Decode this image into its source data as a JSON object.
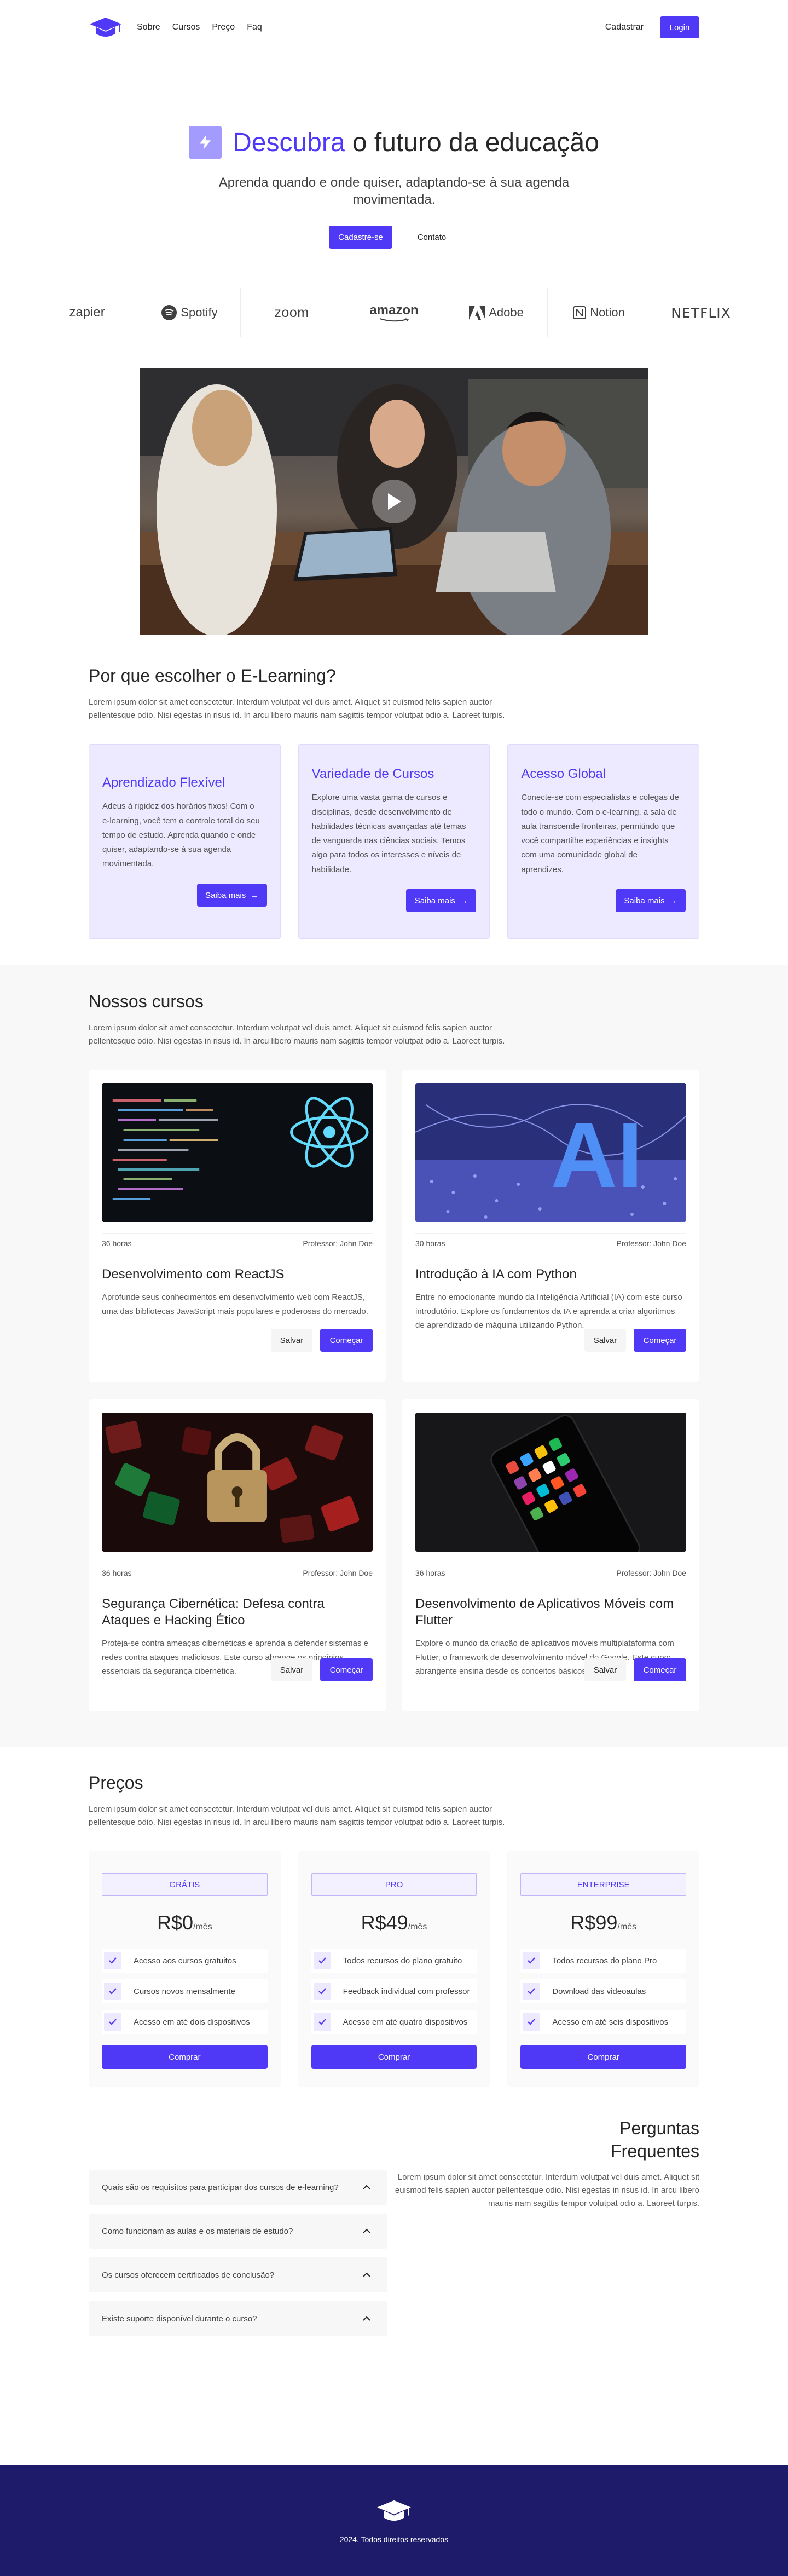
{
  "nav": {
    "links": [
      "Sobre",
      "Cursos",
      "Preço",
      "Faq"
    ],
    "register": "Cadastrar",
    "login": "Login"
  },
  "hero": {
    "title_accent": "Descubra",
    "title_rest": " o futuro da educação",
    "subtitle": "Aprenda quando e onde quiser, adaptando-se à sua agenda movimentada.",
    "cta_primary": "Cadastre-se",
    "cta_secondary": "Contato"
  },
  "brands": [
    "zapier",
    "Spotify",
    "zoom",
    "amazon",
    "Adobe",
    "Notion",
    "NETFLIX"
  ],
  "why": {
    "title": "Por que escolher o E-Learning?",
    "description": "Lorem ipsum dolor sit amet consectetur. Interdum volutpat vel duis amet. Aliquet sit euismod felis sapien auctor pellentesque odio. Nisi egestas in risus id. In arcu libero mauris nam sagittis tempor volutpat odio a. Laoreet turpis.",
    "features": [
      {
        "title": "Aprendizado Flexível",
        "text": "Adeus à rigidez dos horários fixos! Com o e-learning, você tem o controle total do seu tempo de estudo. Aprenda quando e onde quiser, adaptando-se à sua agenda movimentada.",
        "button": "Saiba mais"
      },
      {
        "title": "Variedade de Cursos",
        "text": "Explore uma vasta gama de cursos e disciplinas, desde desenvolvimento de habilidades técnicas avançadas até temas de vanguarda nas ciências sociais. Temos algo para todos os interesses e níveis de habilidade.",
        "button": "Saiba mais"
      },
      {
        "title": "Acesso Global",
        "text": "Conecte-se com especialistas e colegas de todo o mundo. Com o e-learning, a sala de aula transcende fronteiras, permitindo que você compartilhe experiências e insights com uma comunidade global de aprendizes.",
        "button": "Saiba mais"
      }
    ]
  },
  "courses": {
    "title": "Nossos cursos",
    "description": "Lorem ipsum dolor sit amet consectetur. Interdum volutpat vel duis amet. Aliquet sit euismod felis sapien auctor pellentesque odio. Nisi egestas in risus id. In arcu libero mauris nam sagittis tempor volutpat odio a. Laoreet turpis.",
    "items": [
      {
        "duration": "36 horas",
        "teacher": "Professor: John Doe",
        "title": "Desenvolvimento com ReactJS",
        "text": "Aprofunde seus conhecimentos em desenvolvimento web com ReactJS, uma das bibliotecas JavaScript mais populares e poderosas do mercado.",
        "save": "Salvar",
        "start": "Começar"
      },
      {
        "duration": "30 horas",
        "teacher": "Professor: John Doe",
        "title": "Introdução à IA com Python",
        "text": "Entre no emocionante mundo da Inteligência Artificial (IA) com este curso introdutório. Explore os fundamentos da IA e aprenda a criar algoritmos de aprendizado de máquina utilizando Python.",
        "save": "Salvar",
        "start": "Começar"
      },
      {
        "duration": "36 horas",
        "teacher": "Professor: John Doe",
        "title": "Segurança Cibernética: Defesa contra Ataques e Hacking Ético",
        "text": "Proteja-se contra ameaças cibernéticas e aprenda a defender sistemas e redes contra ataques maliciosos. Este curso abrange os princípios essenciais da segurança cibernética.",
        "save": "Salvar",
        "start": "Começar"
      },
      {
        "duration": "36 horas",
        "teacher": "Professor: John Doe",
        "title": "Desenvolvimento de Aplicativos Móveis com Flutter",
        "text": "Explore o mundo da criação de aplicativos móveis multiplataforma com Flutter, o framework de desenvolvimento móvel do Google. Este curso abrangente ensina desde os conceitos básicos.",
        "save": "Salvar",
        "start": "Começar"
      }
    ]
  },
  "pricing": {
    "title": "Preços",
    "description": "Lorem ipsum dolor sit amet consectetur. Interdum volutpat vel duis amet. Aliquet sit euismod felis sapien auctor pellentesque odio. Nisi egestas in risus id. In arcu libero mauris nam sagittis tempor volutpat odio a. Laoreet turpis.",
    "plans": [
      {
        "name": "GRÁTIS",
        "price": "R$0",
        "period": "/mês",
        "features": [
          "Acesso aos cursos gratuitos",
          "Cursos novos mensalmente",
          "Acesso em até dois dispositivos"
        ],
        "button": "Comprar"
      },
      {
        "name": "PRO",
        "price": "R$49",
        "period": "/mês",
        "features": [
          "Todos recursos do plano gratuito",
          "Feedback individual com professor",
          "Acesso em até quatro dispositivos"
        ],
        "button": "Comprar"
      },
      {
        "name": "ENTERPRISE",
        "price": "R$99",
        "period": "/mês",
        "features": [
          "Todos recursos do plano Pro",
          "Download das videoaulas",
          "Acesso em até seis dispositivos"
        ],
        "button": "Comprar"
      }
    ]
  },
  "faq": {
    "title_line1": "Perguntas",
    "title_line2": "Frequentes",
    "description": "Lorem ipsum dolor sit amet consectetur. Interdum volutpat vel duis amet. Aliquet sit euismod felis sapien auctor pellentesque odio. Nisi egestas in risus id. In arcu libero mauris nam sagittis tempor volutpat odio a. Laoreet turpis.",
    "questions": [
      "Quais são os requisitos para participar dos cursos de e-learning?",
      "Como funcionam as aulas e os materiais de estudo?",
      "Os cursos oferecem certificados de conclusão?",
      "Existe suporte disponível durante o curso?"
    ]
  },
  "footer": {
    "copyright": "2024. Todos direitos reservados"
  },
  "colors": {
    "accent": "#4f39f6",
    "accent_light": "#ede9fe",
    "footer_bg": "#1e1b6b"
  }
}
